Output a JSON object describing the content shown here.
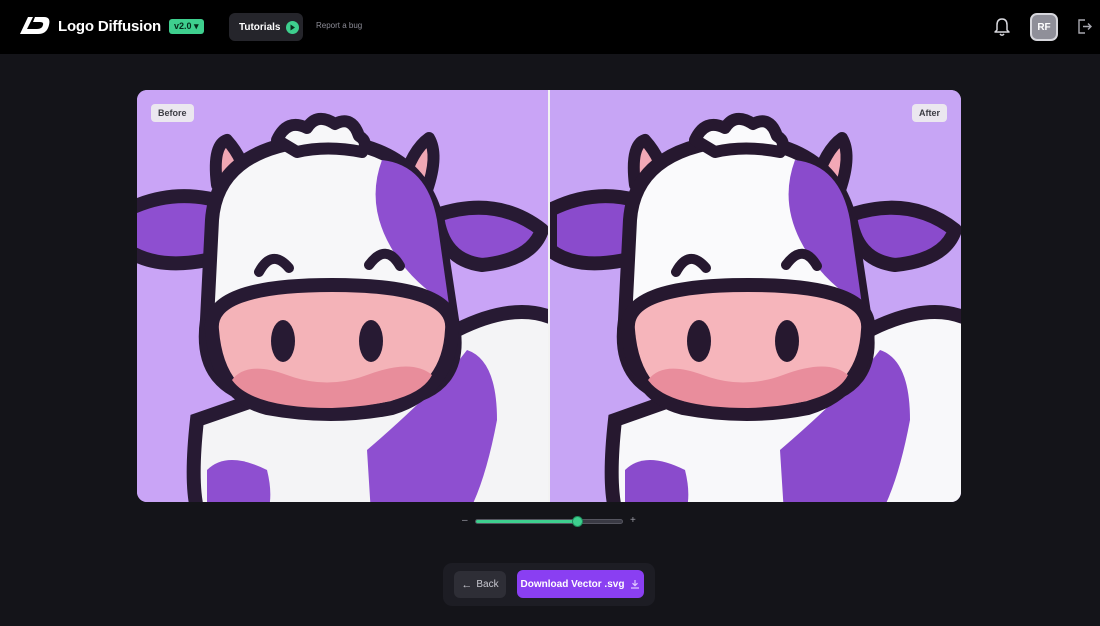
{
  "header": {
    "app_name": "Logo Diffusion",
    "version": "v2.0",
    "tutorials_label": "Tutorials",
    "report_bug_label": "Report a bug",
    "avatar_initials": "RF",
    "icons": [
      "logo-mark-icon",
      "play-icon",
      "bell-icon",
      "logout-icon"
    ]
  },
  "compare": {
    "before_label": "Before",
    "after_label": "After"
  },
  "zoom": {
    "minus_label": "–",
    "plus_label": "+",
    "value_fraction": 0.69
  },
  "actions": {
    "back_label": "Back",
    "download_label": "Download Vector .svg"
  },
  "colors": {
    "accent_green": "#3ecf8e",
    "accent_purple": "#8a3ff2",
    "canvas_lavender": "#c9a4f6",
    "topbar_bg": "#000000",
    "page_bg": "#141419"
  }
}
